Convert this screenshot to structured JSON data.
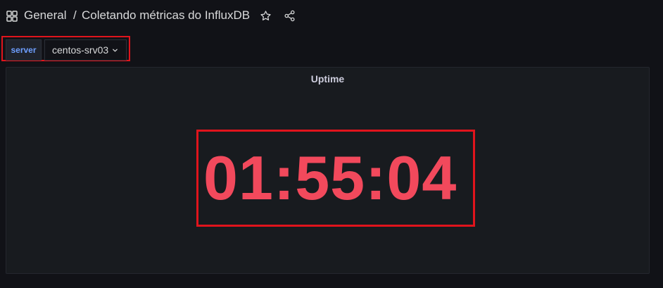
{
  "header": {
    "folder": "General",
    "separator": "/",
    "title": "Coletando métricas do InfluxDB",
    "icons": [
      "apps-grid-icon",
      "star-icon",
      "share-icon"
    ]
  },
  "variables": [
    {
      "label": "server",
      "value": "centos-srv03"
    }
  ],
  "panel": {
    "title": "Uptime",
    "value": "01:55:04",
    "value_color": "#f2495c"
  },
  "colors": {
    "background": "#111217",
    "panel_background": "#181b1f",
    "highlight": "#e0141c",
    "variable_label": "#6e9fff"
  }
}
